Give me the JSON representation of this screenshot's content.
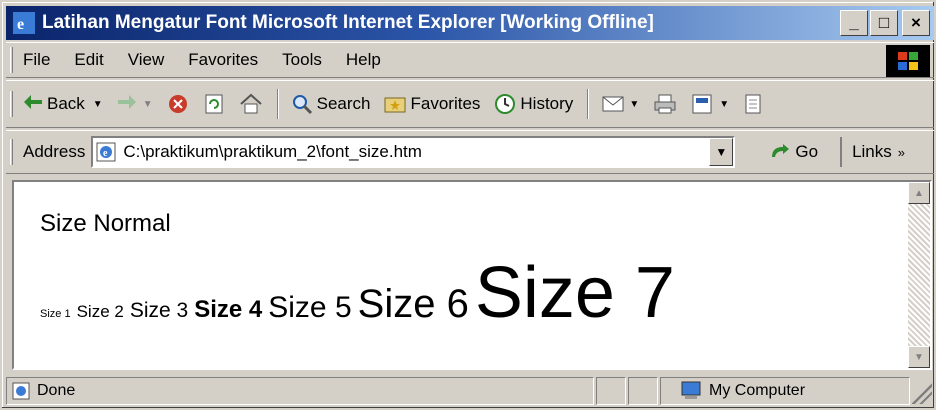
{
  "window": {
    "title": "Latihan Mengatur Font - Microsoft Internet Explorer [Working Offline]",
    "title_display": "Latihan Mengatur Font   Microsoft Internet Explorer   [Working Offline]",
    "minimize": "_",
    "maximize": "□",
    "close": "×"
  },
  "menu": {
    "items": [
      "File",
      "Edit",
      "View",
      "Favorites",
      "Tools",
      "Help"
    ]
  },
  "toolbar": {
    "back": "Back",
    "search": "Search",
    "favorites": "Favorites",
    "history": "History"
  },
  "address": {
    "label": "Address",
    "value": "C:\\praktikum\\praktikum_2\\font_size.htm",
    "go": "Go",
    "links": "Links"
  },
  "content": {
    "normal": "Size Normal",
    "sizes": [
      "Size 1",
      "Size 2",
      "Size 3",
      "Size 4",
      "Size 5",
      "Size 6",
      "Size 7"
    ]
  },
  "status": {
    "text": "Done",
    "zone": "My Computer"
  },
  "colors": {
    "title_gradient_start": "#0a246a",
    "title_gradient_end": "#a6caf0",
    "chrome": "#d4d0c8"
  }
}
